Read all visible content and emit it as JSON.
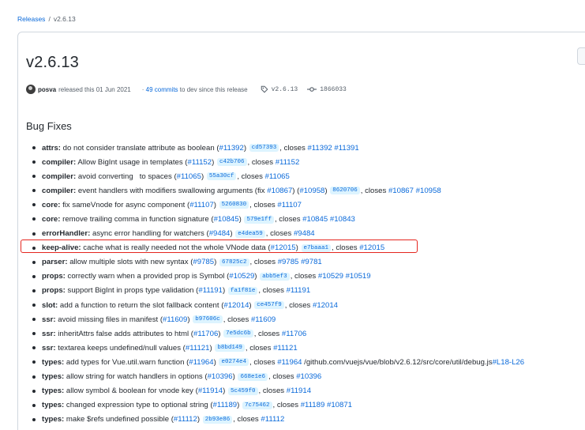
{
  "breadcrumb": {
    "link": "Releases",
    "separator": "/",
    "current": "v2.6.13"
  },
  "release": {
    "title": "v2.6.13",
    "author": "posva",
    "released_text": "released this 01 Jun 2021",
    "commits_prefix": "·",
    "commits_link": "49 commits",
    "commits_suffix": "to dev since this release",
    "tag": "v2.6.13",
    "commit": "1866033"
  },
  "section_title": "Bug Fixes",
  "fixes": [
    {
      "scope": "attrs:",
      "parts": [
        {
          "t": "txt",
          "v": " do not consider translate attribute as boolean ("
        },
        {
          "t": "lnk",
          "v": "#11392"
        },
        {
          "t": "txt",
          "v": ") "
        },
        {
          "t": "hash",
          "v": "cd57393"
        },
        {
          "t": "txt",
          "v": ", closes "
        },
        {
          "t": "lnk",
          "v": "#11392"
        },
        {
          "t": "txt",
          "v": " "
        },
        {
          "t": "lnk",
          "v": "#11391"
        }
      ]
    },
    {
      "scope": "compiler:",
      "parts": [
        {
          "t": "txt",
          "v": " Allow BigInt usage in templates ("
        },
        {
          "t": "lnk",
          "v": "#11152"
        },
        {
          "t": "txt",
          "v": ") "
        },
        {
          "t": "hash",
          "v": "c42b706"
        },
        {
          "t": "txt",
          "v": ", closes "
        },
        {
          "t": "lnk",
          "v": "#11152"
        }
      ]
    },
    {
      "scope": "compiler:",
      "parts": [
        {
          "t": "txt",
          "v": " avoid converting   to spaces ("
        },
        {
          "t": "lnk",
          "v": "#11065"
        },
        {
          "t": "txt",
          "v": ") "
        },
        {
          "t": "hash",
          "v": "55a30cf"
        },
        {
          "t": "txt",
          "v": ", closes "
        },
        {
          "t": "lnk",
          "v": "#11065"
        }
      ]
    },
    {
      "scope": "compiler:",
      "parts": [
        {
          "t": "txt",
          "v": " event handlers with modifiers swallowing arguments (fix "
        },
        {
          "t": "lnk",
          "v": "#10867"
        },
        {
          "t": "txt",
          "v": ") ("
        },
        {
          "t": "lnk",
          "v": "#10958"
        },
        {
          "t": "txt",
          "v": ") "
        },
        {
          "t": "hash",
          "v": "8620706"
        },
        {
          "t": "txt",
          "v": ", closes "
        },
        {
          "t": "lnk",
          "v": "#10867"
        },
        {
          "t": "txt",
          "v": " "
        },
        {
          "t": "lnk",
          "v": "#10958"
        }
      ]
    },
    {
      "scope": "core:",
      "parts": [
        {
          "t": "txt",
          "v": " fix sameVnode for async component ("
        },
        {
          "t": "lnk",
          "v": "#11107"
        },
        {
          "t": "txt",
          "v": ") "
        },
        {
          "t": "hash",
          "v": "5260830"
        },
        {
          "t": "txt",
          "v": ", closes "
        },
        {
          "t": "lnk",
          "v": "#11107"
        }
      ]
    },
    {
      "scope": "core:",
      "parts": [
        {
          "t": "txt",
          "v": " remove trailing comma in function signature ("
        },
        {
          "t": "lnk",
          "v": "#10845"
        },
        {
          "t": "txt",
          "v": ") "
        },
        {
          "t": "hash",
          "v": "579e1ff"
        },
        {
          "t": "txt",
          "v": ", closes "
        },
        {
          "t": "lnk",
          "v": "#10845"
        },
        {
          "t": "txt",
          "v": " "
        },
        {
          "t": "lnk",
          "v": "#10843"
        }
      ]
    },
    {
      "scope": "errorHandler:",
      "parts": [
        {
          "t": "txt",
          "v": " async error handling for watchers ("
        },
        {
          "t": "lnk",
          "v": "#9484"
        },
        {
          "t": "txt",
          "v": ") "
        },
        {
          "t": "hash",
          "v": "e4dea59"
        },
        {
          "t": "txt",
          "v": ", closes "
        },
        {
          "t": "lnk",
          "v": "#9484"
        }
      ]
    },
    {
      "scope": "keep-alive:",
      "parts": [
        {
          "t": "txt",
          "v": " cache what is really needed not the whole VNode data ("
        },
        {
          "t": "lnk",
          "v": "#12015"
        },
        {
          "t": "txt",
          "v": ") "
        },
        {
          "t": "hash",
          "v": "e7baaa1"
        },
        {
          "t": "txt",
          "v": ", closes "
        },
        {
          "t": "lnk",
          "v": "#12015"
        }
      ]
    },
    {
      "scope": "parser:",
      "parts": [
        {
          "t": "txt",
          "v": " allow multiple slots with new syntax ("
        },
        {
          "t": "lnk",
          "v": "#9785"
        },
        {
          "t": "txt",
          "v": ") "
        },
        {
          "t": "hash",
          "v": "67825c2"
        },
        {
          "t": "txt",
          "v": ", closes "
        },
        {
          "t": "lnk",
          "v": "#9785"
        },
        {
          "t": "txt",
          "v": " "
        },
        {
          "t": "lnk",
          "v": "#9781"
        }
      ]
    },
    {
      "scope": "props:",
      "parts": [
        {
          "t": "txt",
          "v": " correctly warn when a provided prop is Symbol ("
        },
        {
          "t": "lnk",
          "v": "#10529"
        },
        {
          "t": "txt",
          "v": ") "
        },
        {
          "t": "hash",
          "v": "abb5ef3"
        },
        {
          "t": "txt",
          "v": ", closes "
        },
        {
          "t": "lnk",
          "v": "#10529"
        },
        {
          "t": "txt",
          "v": " "
        },
        {
          "t": "lnk",
          "v": "#10519"
        }
      ]
    },
    {
      "scope": "props:",
      "parts": [
        {
          "t": "txt",
          "v": " support BigInt in props type validation ("
        },
        {
          "t": "lnk",
          "v": "#11191"
        },
        {
          "t": "txt",
          "v": ") "
        },
        {
          "t": "hash",
          "v": "fa1f81e"
        },
        {
          "t": "txt",
          "v": ", closes "
        },
        {
          "t": "lnk",
          "v": "#11191"
        }
      ]
    },
    {
      "scope": "slot:",
      "parts": [
        {
          "t": "txt",
          "v": " add a function to return the slot fallback content ("
        },
        {
          "t": "lnk",
          "v": "#12014"
        },
        {
          "t": "txt",
          "v": ") "
        },
        {
          "t": "hash",
          "v": "ce457f9"
        },
        {
          "t": "txt",
          "v": ", closes "
        },
        {
          "t": "lnk",
          "v": "#12014"
        }
      ]
    },
    {
      "scope": "ssr:",
      "parts": [
        {
          "t": "txt",
          "v": " avoid missing files in manifest ("
        },
        {
          "t": "lnk",
          "v": "#11609"
        },
        {
          "t": "txt",
          "v": ") "
        },
        {
          "t": "hash",
          "v": "b97606c"
        },
        {
          "t": "txt",
          "v": ", closes "
        },
        {
          "t": "lnk",
          "v": "#11609"
        }
      ]
    },
    {
      "scope": "ssr:",
      "parts": [
        {
          "t": "txt",
          "v": " inheritAttrs false adds attributes to html ("
        },
        {
          "t": "lnk",
          "v": "#11706"
        },
        {
          "t": "txt",
          "v": ") "
        },
        {
          "t": "hash",
          "v": "7e5dc6b"
        },
        {
          "t": "txt",
          "v": ", closes "
        },
        {
          "t": "lnk",
          "v": "#11706"
        }
      ]
    },
    {
      "scope": "ssr:",
      "parts": [
        {
          "t": "txt",
          "v": " textarea keeps undefined/null values ("
        },
        {
          "t": "lnk",
          "v": "#11121"
        },
        {
          "t": "txt",
          "v": ") "
        },
        {
          "t": "hash",
          "v": "b8bd149"
        },
        {
          "t": "txt",
          "v": ", closes "
        },
        {
          "t": "lnk",
          "v": "#11121"
        }
      ]
    },
    {
      "scope": "types:",
      "parts": [
        {
          "t": "txt",
          "v": " add types for Vue.util.warn function ("
        },
        {
          "t": "lnk",
          "v": "#11964"
        },
        {
          "t": "txt",
          "v": ") "
        },
        {
          "t": "hash",
          "v": "e0274e4"
        },
        {
          "t": "txt",
          "v": ", closes "
        },
        {
          "t": "lnk",
          "v": "#11964"
        },
        {
          "t": "txt",
          "v": " /github.com/vuejs/vue/blob/v2.6.12/src/core/util/debug.js"
        },
        {
          "t": "lnk",
          "v": "#L18-L26"
        }
      ]
    },
    {
      "scope": "types:",
      "parts": [
        {
          "t": "txt",
          "v": " allow string for watch handlers in options ("
        },
        {
          "t": "lnk",
          "v": "#10396"
        },
        {
          "t": "txt",
          "v": ") "
        },
        {
          "t": "hash",
          "v": "668e1e6"
        },
        {
          "t": "txt",
          "v": ", closes "
        },
        {
          "t": "lnk",
          "v": "#10396"
        }
      ]
    },
    {
      "scope": "types:",
      "parts": [
        {
          "t": "txt",
          "v": " allow symbol & boolean for vnode key ("
        },
        {
          "t": "lnk",
          "v": "#11914"
        },
        {
          "t": "txt",
          "v": ") "
        },
        {
          "t": "hash",
          "v": "5c459f0"
        },
        {
          "t": "txt",
          "v": ", closes "
        },
        {
          "t": "lnk",
          "v": "#11914"
        }
      ]
    },
    {
      "scope": "types:",
      "parts": [
        {
          "t": "txt",
          "v": " changed expression type to optional string ("
        },
        {
          "t": "lnk",
          "v": "#11189"
        },
        {
          "t": "txt",
          "v": ") "
        },
        {
          "t": "hash",
          "v": "7c75462"
        },
        {
          "t": "txt",
          "v": ", closes "
        },
        {
          "t": "lnk",
          "v": "#11189"
        },
        {
          "t": "txt",
          "v": " "
        },
        {
          "t": "lnk",
          "v": "#10871"
        }
      ]
    },
    {
      "scope": "types:",
      "parts": [
        {
          "t": "txt",
          "v": " make $refs undefined possible ("
        },
        {
          "t": "lnk",
          "v": "#11112"
        },
        {
          "t": "txt",
          "v": ") "
        },
        {
          "t": "hash",
          "v": "2b93e86"
        },
        {
          "t": "txt",
          "v": ", closes "
        },
        {
          "t": "lnk",
          "v": "#11112"
        }
      ]
    }
  ],
  "highlighted_index": 7,
  "colors": {
    "link": "#0969da",
    "hash_bg": "#ddf4ff",
    "highlight": "#e5261f",
    "border": "#d0d7de"
  }
}
